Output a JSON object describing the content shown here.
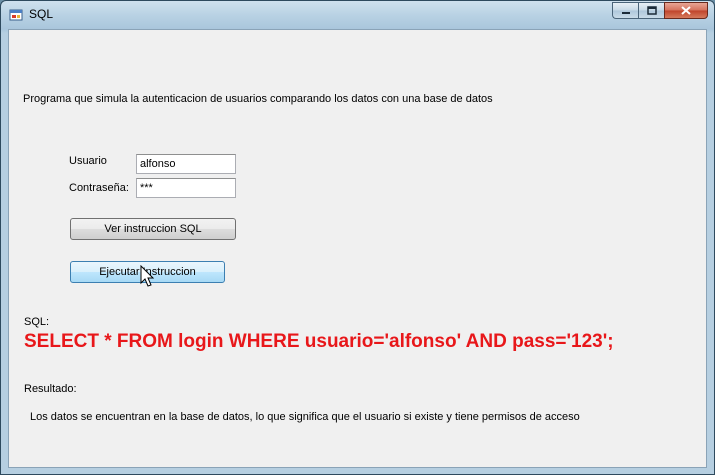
{
  "window": {
    "title": "SQL",
    "icon": "sql-form-icon"
  },
  "caption_buttons": {
    "minimize_icon": "minimize-icon",
    "maximize_icon": "maximize-icon",
    "close_icon": "close-icon"
  },
  "description": "Programa que simula la autenticacion de usuarios comparando los datos con una base de datos",
  "form": {
    "user_label": "Usuario",
    "user_value": "alfonso",
    "password_label": "Contraseña:",
    "password_value": "***"
  },
  "buttons": {
    "view_sql": "Ver instruccion SQL",
    "execute": "Ejecutar Instruccion"
  },
  "sql": {
    "label": "SQL:",
    "statement": "SELECT * FROM login WHERE usuario='alfonso' AND pass='123';",
    "color": "#e8171a"
  },
  "result": {
    "label": "Resultado:",
    "message": "Los datos se encuentran en la base de datos, lo que significa que el usuario si existe y tiene permisos de acceso"
  }
}
